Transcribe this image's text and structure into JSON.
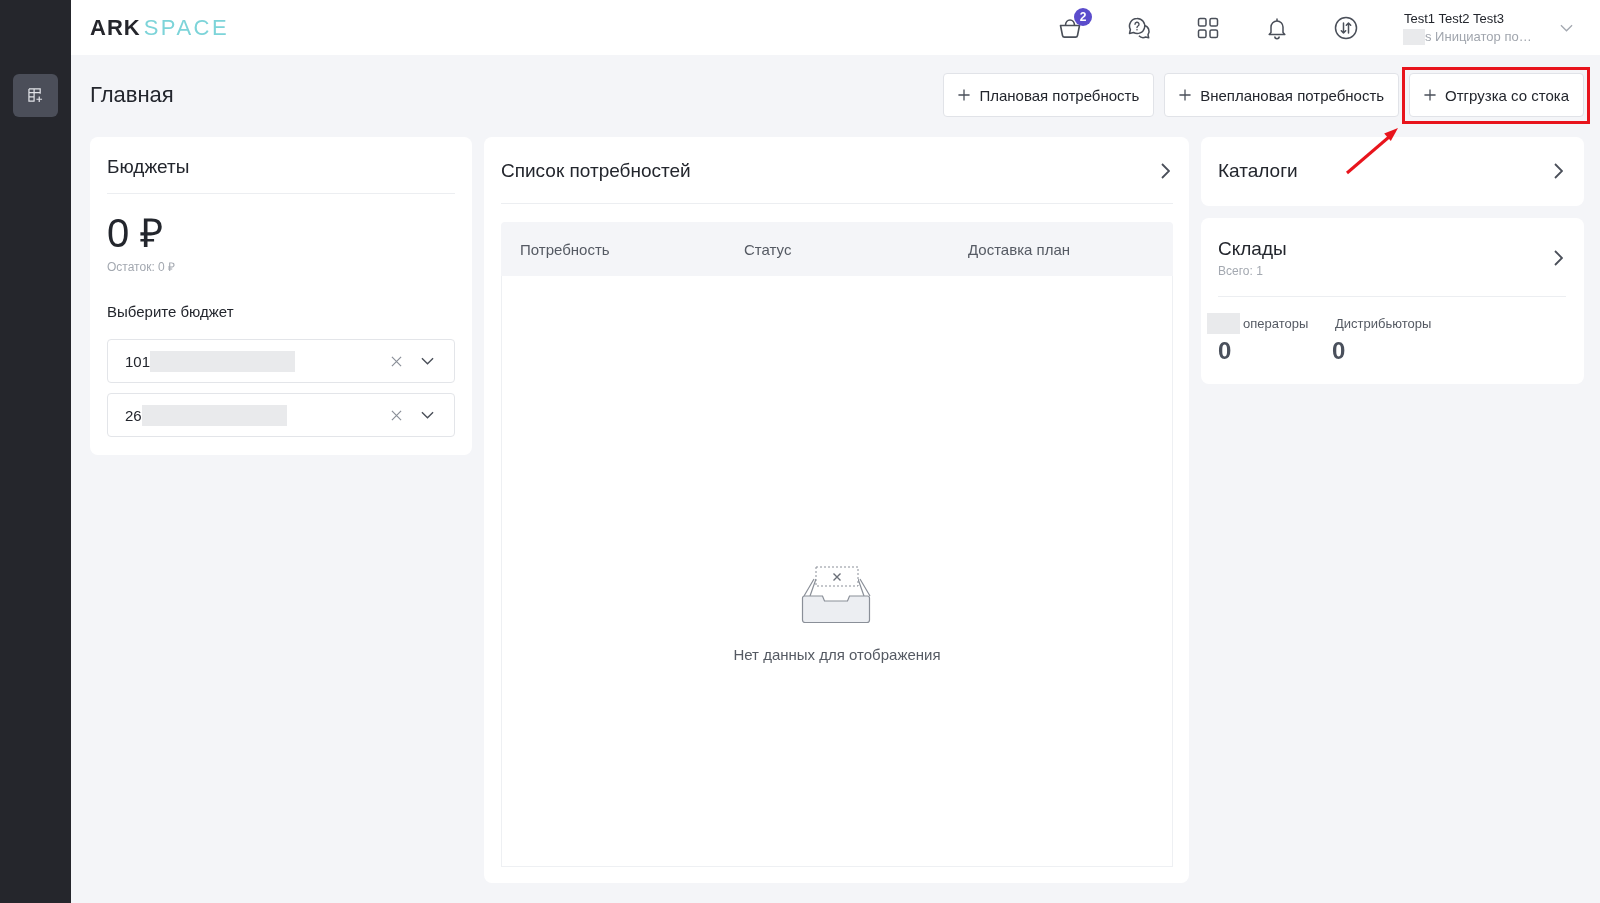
{
  "sidebar": {
    "items": [
      {
        "kind": "table-add",
        "selected": true
      }
    ]
  },
  "header": {
    "logo": {
      "bold": "ARK",
      "light": "SPACE"
    },
    "icons": [
      {
        "kind": "basket",
        "badge": "2"
      },
      {
        "kind": "help-chat"
      },
      {
        "kind": "apps-grid"
      },
      {
        "kind": "bell"
      },
      {
        "kind": "exchange"
      }
    ],
    "user": {
      "name": "Test1 Test2 Test3",
      "role": "s Инициатор по…",
      "role_masked": true
    }
  },
  "page": {
    "title": "Главная",
    "actions": [
      {
        "label": "Плановая потребность",
        "highlighted": false
      },
      {
        "label": "Внеплановая потребность",
        "highlighted": false
      },
      {
        "label": "Отгрузка со стока",
        "highlighted": true
      }
    ]
  },
  "budgets": {
    "title": "Бюджеты",
    "amount": "0 ₽",
    "remainder": "Остаток: 0 ₽",
    "select_label": "Выберите бюджет",
    "selects": [
      {
        "value": "101",
        "masked": true
      },
      {
        "value": "26",
        "masked": true
      }
    ]
  },
  "needs": {
    "title": "Список потребностей",
    "table": {
      "columns": [
        "Потребность",
        "Статус",
        "Доставка план"
      ],
      "empty_text": "Нет данных для отображения"
    }
  },
  "catalogs": {
    "title": "Каталоги"
  },
  "warehouses": {
    "title": "Склады",
    "total": "Всего: 1",
    "stats": [
      {
        "label": "операторы",
        "value": "0",
        "masked": true
      },
      {
        "label": "Дистрибьюторы",
        "value": "0",
        "masked": false
      }
    ]
  }
}
